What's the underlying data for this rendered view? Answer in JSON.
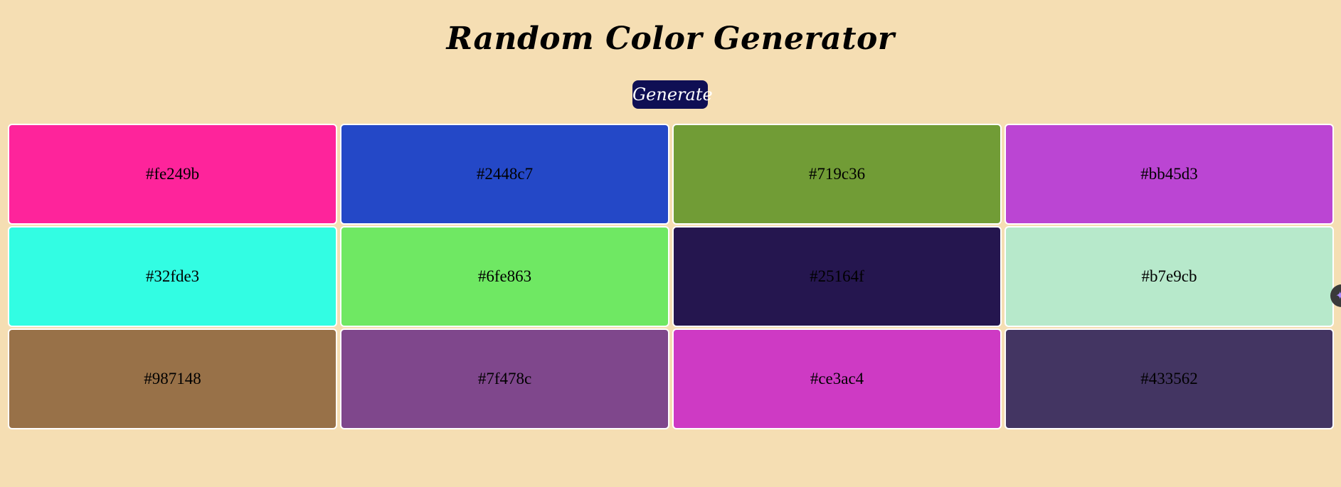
{
  "header": {
    "title": "Random Color Generator",
    "generate_label": "Generate"
  },
  "palette": {
    "cards": [
      {
        "code": "#fe249b"
      },
      {
        "code": "#2448c7"
      },
      {
        "code": "#719c36"
      },
      {
        "code": "#bb45d3"
      },
      {
        "code": "#32fde3"
      },
      {
        "code": "#6fe863"
      },
      {
        "code": "#25164f"
      },
      {
        "code": "#b7e9cb"
      },
      {
        "code": "#987148"
      },
      {
        "code": "#7f478c"
      },
      {
        "code": "#ce3ac4"
      },
      {
        "code": "#433562"
      }
    ]
  },
  "side_handle": {
    "icon": "sparkle-icon",
    "glyph": "✦"
  },
  "colors": {
    "background": "#f5deb3",
    "button": "#0f0f54",
    "card_border": "#ffffff"
  }
}
